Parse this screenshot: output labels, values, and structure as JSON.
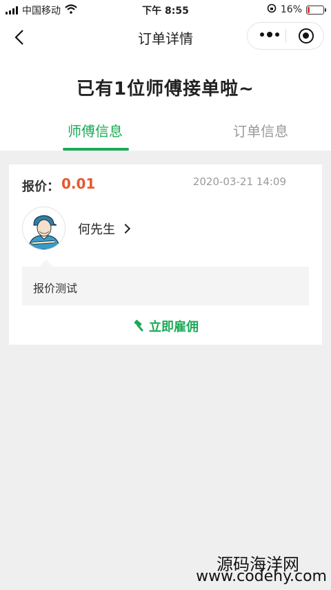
{
  "status_bar": {
    "carrier": "中国移动",
    "time": "下午 8:55",
    "battery": "16%",
    "battery_level": 0.16
  },
  "nav": {
    "title": "订单详情"
  },
  "headline": "已有1位师傅接单啦~",
  "tabs": [
    {
      "label": "师傅信息",
      "active": true
    },
    {
      "label": "订单信息",
      "active": false
    }
  ],
  "card": {
    "price_label": "报价：",
    "price_value": "0.01",
    "date": "2020-03-21 14:09",
    "worker_name": "何先生",
    "message": "报价测试",
    "hire_label": "立即雇佣"
  },
  "watermark": {
    "line1": "源码海洋网",
    "line2": "www.codehy.com"
  },
  "colors": {
    "accent": "#1aaa55",
    "price": "#e8572c",
    "background": "#efefef"
  },
  "icons": [
    "signal-icon",
    "wifi-icon",
    "lock-rotation-icon",
    "battery-icon",
    "back-icon",
    "more-dots-icon",
    "target-icon",
    "chevron-right-icon",
    "hammer-icon"
  ]
}
